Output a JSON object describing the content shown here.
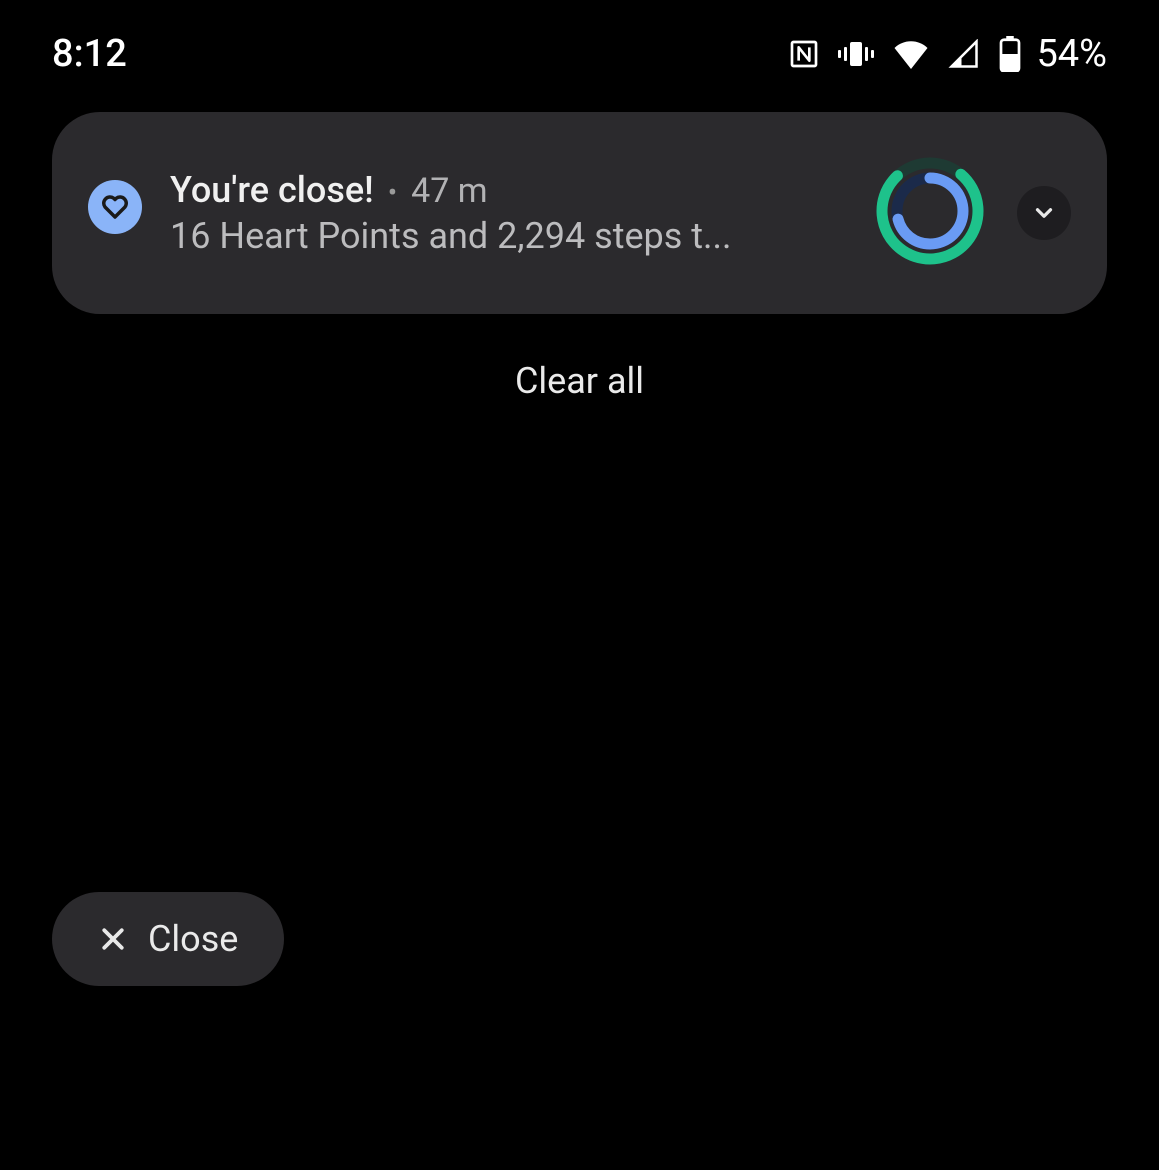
{
  "status": {
    "time": "8:12",
    "battery_text": "54%"
  },
  "notification": {
    "title": "You're close!",
    "age": "47 m",
    "subtitle": "16 Heart Points and 2,294 steps t..."
  },
  "actions": {
    "clear_all": "Clear all",
    "close": "Close"
  }
}
